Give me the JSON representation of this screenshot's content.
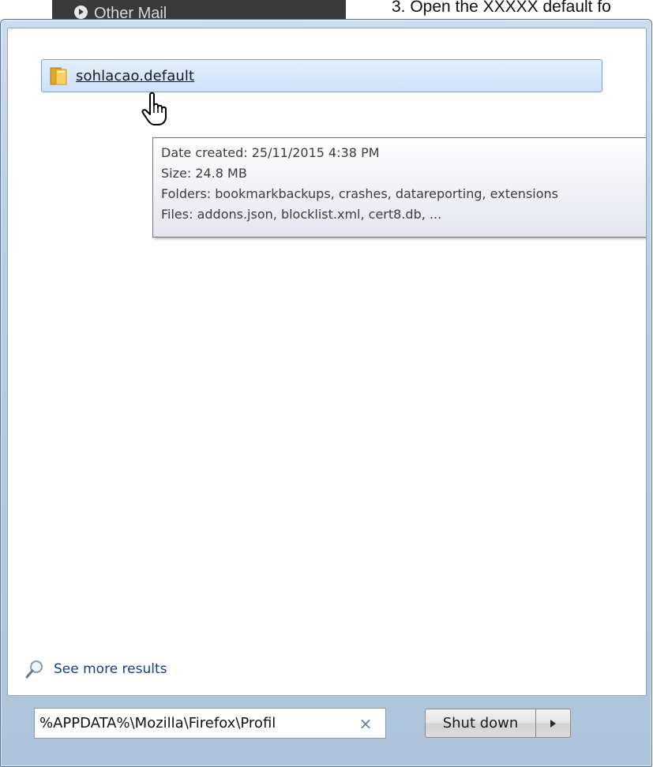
{
  "background": {
    "nav_item": "Other Mail",
    "heading": "3. Open the XXXXX default fo"
  },
  "search_results": {
    "items": [
      {
        "name": "sohlacao.default",
        "icon": "folder-icon"
      }
    ],
    "tooltip": {
      "date_created": "Date created: 25/11/2015 4:38 PM",
      "size": "Size: 24.8 MB",
      "folders": "Folders: bookmarkbackups, crashes, datareporting, extensions",
      "files": "Files: addons.json, blocklist.xml, cert8.db, ..."
    },
    "see_more": {
      "label": "See more results",
      "icon": "magnifier-icon"
    }
  },
  "search_box": {
    "value": "%APPDATA%\\Mozilla\\Firefox\\Profil",
    "clear_icon": "×"
  },
  "power": {
    "shutdown_label": "Shut down",
    "options_icon": "arrow-right-icon"
  },
  "colors": {
    "selection_bg": "#cfe2f9",
    "selection_border": "#7da2ce",
    "link_text": "#1c3a8a",
    "frame": "#b7cde2"
  }
}
